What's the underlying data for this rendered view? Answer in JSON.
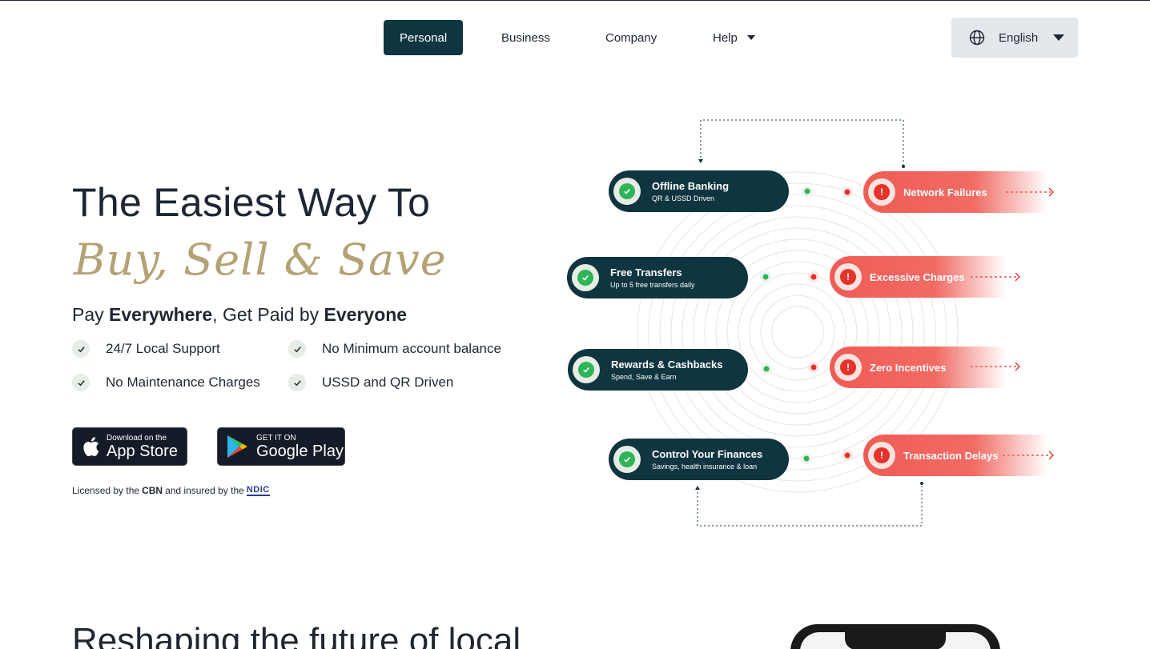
{
  "nav": {
    "items": [
      {
        "label": "Personal"
      },
      {
        "label": "Business"
      },
      {
        "label": "Company"
      },
      {
        "label": "Help"
      }
    ],
    "language": "English"
  },
  "hero": {
    "title": "The Easiest Way To",
    "script": "Buy, Sell & Save",
    "subtitle": {
      "p1": "Pay ",
      "b1": "Everywhere",
      "p2": ", Get Paid by ",
      "b2": "Everyone"
    },
    "features": [
      "24/7 Local Support",
      "No Minimum account balance",
      "No Maintenance Charges",
      "USSD and QR Driven"
    ],
    "app_store": {
      "small": "Download on the",
      "big": "App Store"
    },
    "google_play": {
      "small": "GET IT ON",
      "big": "Google Play"
    },
    "license": {
      "p1": "Licensed by the",
      "cbn": "CBN",
      "p2": "and insured by the",
      "ndic": "NDIC"
    }
  },
  "diagram": {
    "good": [
      {
        "title": "Offline Banking",
        "sub": "QR & USSD Driven"
      },
      {
        "title": "Free Transfers",
        "sub": "Up to 5 free transfers daily"
      },
      {
        "title": "Rewards & Cashbacks",
        "sub": "Spend, Save & Earn"
      },
      {
        "title": "Control Your Finances",
        "sub": "Savings, health insurance & loan"
      }
    ],
    "bad": [
      {
        "title": "Network Failures"
      },
      {
        "title": "Excessive Charges"
      },
      {
        "title": "Zero Incentives"
      },
      {
        "title": "Transaction Delays"
      }
    ],
    "colors": {
      "good": "#0f3540",
      "bad": "#ef5c55",
      "accent": "#b3a274"
    }
  },
  "section2": {
    "title": "Reshaping the future of local"
  }
}
